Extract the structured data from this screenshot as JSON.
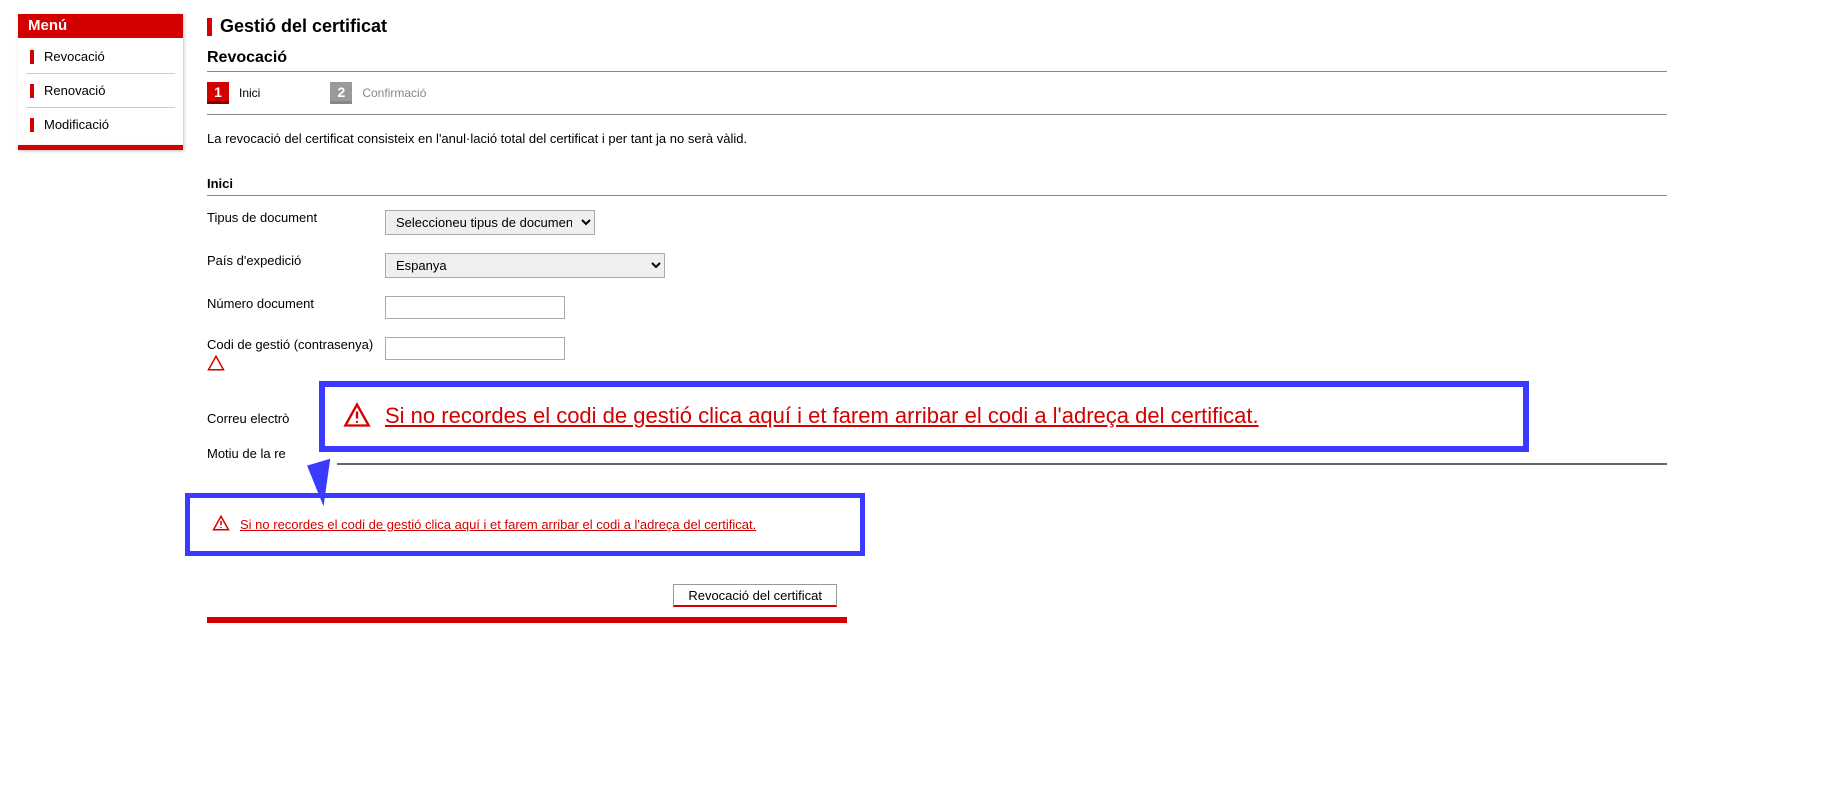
{
  "sidebar": {
    "title": "Menú",
    "items": [
      {
        "label": "Revocació"
      },
      {
        "label": "Renovació"
      },
      {
        "label": "Modificació"
      }
    ]
  },
  "page": {
    "title": "Gestió del certificat",
    "section": "Revocació",
    "intro": "La revocació del certificat consisteix en l'anul·lació total del certificat i per tant ja no serà vàlid."
  },
  "steps": [
    {
      "num": "1",
      "label": "Inici",
      "active": true
    },
    {
      "num": "2",
      "label": "Confirmació",
      "active": false
    }
  ],
  "form": {
    "block_title": "Inici",
    "doc_type_label": "Tipus de document",
    "doc_type_selected": "Seleccioneu tipus de document",
    "country_label": "País d'expedició",
    "country_selected": "Espanya",
    "doc_num_label": "Número document",
    "doc_num_value": "",
    "code_label": "Codi de gestió (contrasenya)",
    "code_value": "",
    "email_label": "Correu electrò",
    "motiu_label": "Motiu de la re"
  },
  "callout": {
    "text": "Si no recordes el codi de gestió clica aquí i et farem arribar el codi a l'adreça del certificat."
  },
  "action": {
    "button": "Revocació del certificat"
  }
}
